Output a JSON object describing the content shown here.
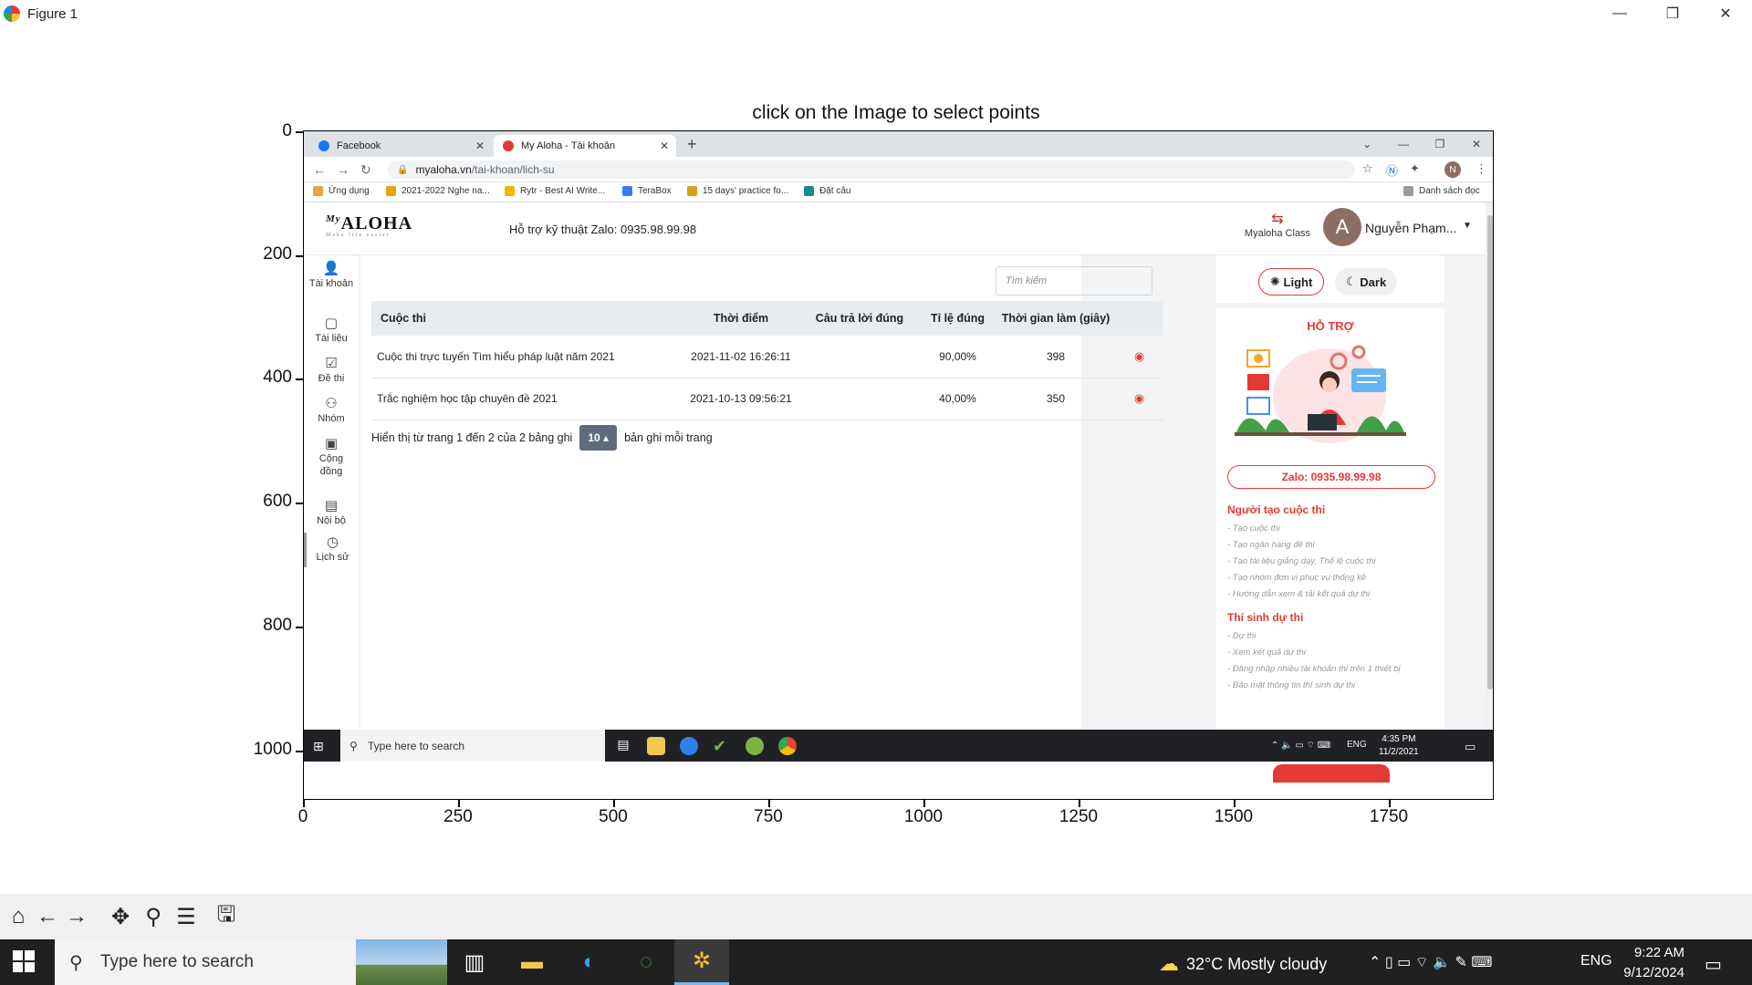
{
  "figure": {
    "window_title": "Figure 1",
    "plot_title": "click on the Image to select points",
    "window_controls": [
      "—",
      "❐",
      "✕"
    ]
  },
  "axes": {
    "yticks": [
      "0",
      "200",
      "400",
      "600",
      "800",
      "1000"
    ],
    "xticks": [
      "0",
      "250",
      "500",
      "750",
      "1000",
      "1250",
      "1500",
      "1750"
    ]
  },
  "browser": {
    "tabs": [
      {
        "label": "Facebook",
        "active": false,
        "color": "#1877f2"
      },
      {
        "label": "My Aloha - Tài khoản",
        "active": true,
        "color": "#e53935"
      }
    ],
    "url_host": "myaloha.vn",
    "url_path": "/tai-khoan/lich-su",
    "profile_initial": "N",
    "bookmarks": [
      {
        "label": "Ứng dụng",
        "color": "#e8a33d"
      },
      {
        "label": "2021-2022 Nghe na...",
        "color": "#e0a800"
      },
      {
        "label": "Rytr - Best AI Write...",
        "color": "#f5b400"
      },
      {
        "label": "TeraBox",
        "color": "#2f80ed"
      },
      {
        "label": "15 days' practice fo...",
        "color": "#d4a017"
      },
      {
        "label": "Đặt câu",
        "color": "#1b8a8a"
      }
    ],
    "reading_list": "Danh sách đọc"
  },
  "site": {
    "logo_text": "ALOHA",
    "logo_prefix": "My",
    "logo_tagline": "Make life easier",
    "support_text": "Hỗ trợ kỹ thuật Zalo: 0935.98.99.98",
    "class_link": "Myaloha Class",
    "avatar_initial": "A",
    "username": "Nguyễn Phạm...",
    "sidenav": [
      {
        "label": "Tài khoản",
        "icon": "user-icon"
      },
      {
        "label": "Tài liệu",
        "icon": "note-icon"
      },
      {
        "label": "Đề thi",
        "icon": "checklist-icon"
      },
      {
        "label": "Nhóm",
        "icon": "add-user-icon"
      },
      {
        "label": "Cộng đồng",
        "icon": "community-icon"
      },
      {
        "label": "Nội bộ",
        "icon": "id-card-icon"
      },
      {
        "label": "Lịch sử",
        "icon": "history-icon"
      }
    ],
    "search_placeholder": "Tìm kiếm",
    "table": {
      "headers": [
        "Cuộc thi",
        "Thời điểm",
        "Câu trả lời đúng",
        "Tỉ lệ đúng",
        "Thời gian làm (giây)",
        ""
      ],
      "rows": [
        [
          "Cuộc thi trực tuyến Tìm hiểu pháp luật năm 2021",
          "2021-11-02 16:26:11",
          "",
          "90,00%",
          "398"
        ],
        [
          "Trắc nghiệm học tập chuyên đề 2021",
          "2021-10-13 09:56:21",
          "",
          "40,00%",
          "350"
        ]
      ]
    },
    "pager": {
      "before": "Hiển thị từ trang 1 đến 2 của 2 bảng ghi",
      "page_size": "10",
      "after": "bản ghi mỗi trang"
    },
    "theme": {
      "light": "Light",
      "dark": "Dark"
    },
    "support_panel": {
      "title": "HỖ TRỢ",
      "zalo": "Zalo: 0935.98.99.98",
      "creator_title": "Người tạo cuộc thi",
      "creator_items": [
        "- Tạo cuộc thi",
        "- Tạo ngân hàng đề thi",
        "- Tạo tài liệu giảng dạy, Thể lệ cuộc thi",
        "- Tạo nhóm đơn vị phục vụ thống kê",
        "- Hướng dẫn xem & tải kết quả dự thi"
      ],
      "candidate_title": "Thí sinh dự thi",
      "candidate_items": [
        "- Dự thi",
        "- Xem kết quả dự thi",
        "- Đăng nhập nhiều tài khoản thi trên 1 thiết bị",
        "- Bảo mật thông tin thí sinh dự thi"
      ]
    }
  },
  "inner_taskbar": {
    "search_placeholder": "Type here to search",
    "lang": "ENG",
    "time": "4:35 PM",
    "date": "11/2/2021"
  },
  "toolbar": {
    "buttons": [
      {
        "name": "home-icon",
        "glyph": "⌂"
      },
      {
        "name": "back-arrow-icon",
        "glyph": "←"
      },
      {
        "name": "forward-arrow-icon",
        "glyph": "→"
      },
      {
        "name": "pan-icon",
        "glyph": "✥"
      },
      {
        "name": "zoom-icon",
        "glyph": "⚲"
      },
      {
        "name": "configure-subplots-icon",
        "glyph": "☰"
      },
      {
        "name": "save-icon",
        "glyph": "🖫"
      }
    ]
  },
  "os_taskbar": {
    "search_placeholder": "Type here to search",
    "weather": "32°C  Mostly cloudy",
    "lang": "ENG",
    "time": "9:22 AM",
    "date": "9/12/2024"
  }
}
